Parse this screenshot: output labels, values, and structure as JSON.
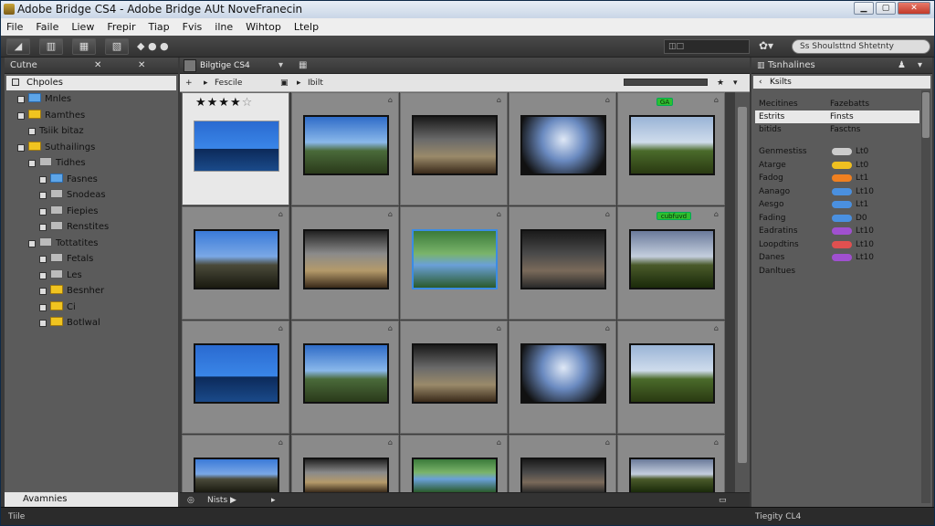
{
  "window": {
    "title": "Adobe Bridge CS4 - Adobe Bridge AUt NoveFranecin",
    "controls": [
      "▁",
      "▢",
      "✕"
    ]
  },
  "menu": [
    "File",
    "Faile",
    "Liew",
    "Frepir",
    "Tiap",
    "Fvis",
    "ilne",
    "Wihtop",
    "Ltelp"
  ],
  "toolbar": {
    "buttons": [
      "◢",
      "▥",
      "▦",
      "▧"
    ],
    "text": "◆ ●  ●",
    "field_value": "◫□",
    "search_text": "Ss Shoulsttnd Shtetnty"
  },
  "left_panel": {
    "tabs": [
      "Cutne",
      "✕",
      "✕"
    ],
    "folders_label": "Chpoles",
    "items": [
      {
        "label": "Mnles",
        "icon": "folder-open",
        "depth": 1
      },
      {
        "label": "Ramthes",
        "icon": "folder-yellow",
        "depth": 1
      },
      {
        "label": "Tsiik bitaz",
        "icon": "none",
        "depth": 2
      },
      {
        "label": "Suthailings",
        "icon": "folder-yellow",
        "depth": 1
      },
      {
        "label": "Tidhes",
        "icon": "folder-grey",
        "depth": 2
      },
      {
        "label": "Fasnes",
        "icon": "folder-open",
        "depth": 3
      },
      {
        "label": "Snodeas",
        "icon": "folder-grey",
        "depth": 3
      },
      {
        "label": "Fiepies",
        "icon": "folder-grey",
        "depth": 3
      },
      {
        "label": "Renstites",
        "icon": "folder-grey",
        "depth": 3
      },
      {
        "label": "Tottatites",
        "icon": "folder-grey",
        "depth": 2
      },
      {
        "label": "Fetals",
        "icon": "folder-grey",
        "depth": 3
      },
      {
        "label": "Les",
        "icon": "folder-grey",
        "depth": 3
      },
      {
        "label": "Besnher",
        "icon": "folder-yellow",
        "depth": 3
      },
      {
        "label": "Ci",
        "icon": "folder-yellow",
        "depth": 3
      },
      {
        "label": "Botlwal",
        "icon": "folder-yellow",
        "depth": 3
      }
    ],
    "favorites_label": "Avamnies"
  },
  "content": {
    "tab_label": "Bilgtige CS4",
    "path_label": "Fescile",
    "path_label2": "Ibilt",
    "rating_stars_filled": 4,
    "rating_stars_total": 5,
    "badges": [
      "GA",
      "cubfuvd"
    ],
    "status_text": "Nists ▶",
    "status_icon": "◎"
  },
  "right_panel": {
    "tab_label": "Tsnhalines",
    "header": "Ksilts",
    "sub_header_key": "Mecitines",
    "sub_header_val": "Fazebatts",
    "rows_plain": [
      {
        "k": "Estrits",
        "v": "Finsts",
        "hl": true
      },
      {
        "k": "bitids",
        "v": "Fasctns",
        "hl": false
      }
    ],
    "rows_pill": [
      {
        "k": "Genmestiss",
        "color": "#cccccc",
        "v": "Lt0"
      },
      {
        "k": "Atarge",
        "color": "#f0c020",
        "v": "Lt0"
      },
      {
        "k": "Fadog",
        "color": "#f08020",
        "v": "Lt1"
      },
      {
        "k": "Aanago",
        "color": "#4a90e0",
        "v": "Lt10"
      },
      {
        "k": "Aesgo",
        "color": "#4a90e0",
        "v": "Lt1"
      },
      {
        "k": "Fading",
        "color": "#4a90e0",
        "v": "D0"
      },
      {
        "k": "Eadratins",
        "color": "#a050d0",
        "v": "Lt10"
      },
      {
        "k": "Loopdtins",
        "color": "#e05050",
        "v": "Lt10"
      },
      {
        "k": "Danes",
        "color": "#a050d0",
        "v": "Lt10"
      }
    ],
    "last_row": "Danltues"
  },
  "bottom": {
    "left": "Tiile",
    "right": "Tiegity CL4"
  },
  "colors": {
    "accent_blue": "#3b8ce4",
    "label_green": "#2fbf2f",
    "panel_bg": "#5b5b5b"
  }
}
